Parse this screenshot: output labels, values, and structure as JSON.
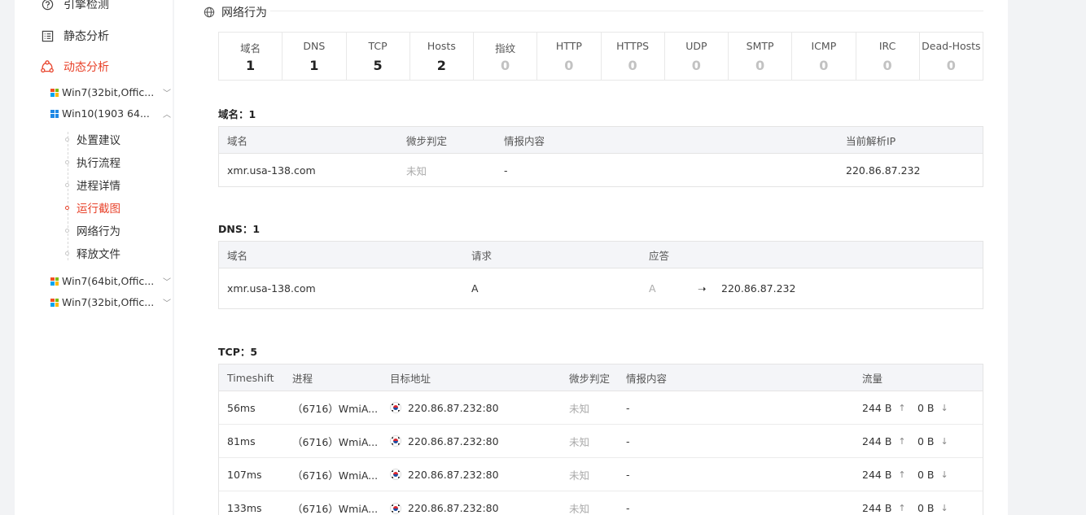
{
  "sidebar": {
    "nav": [
      {
        "label": "引擎检测",
        "icon": "question-circle-icon"
      },
      {
        "label": "静态分析",
        "icon": "list-icon"
      },
      {
        "label": "动态分析",
        "icon": "nodes-icon",
        "active": true
      }
    ],
    "envs": [
      {
        "label": "Win7(32bit,Offic...",
        "icon": "windows-xp-icon",
        "expanded": false
      },
      {
        "label": "Win10(1903 64...",
        "icon": "windows-10-icon",
        "expanded": true
      },
      {
        "label": "Win7(64bit,Offic...",
        "icon": "windows-xp-icon",
        "expanded": false
      },
      {
        "label": "Win7(32bit,Offic...",
        "icon": "windows-xp-icon",
        "expanded": false
      }
    ],
    "sub_items": [
      "处置建议",
      "执行流程",
      "进程详情",
      "运行截图",
      "网络行为",
      "释放文件"
    ],
    "active_sub": "运行截图"
  },
  "main": {
    "section_title": "网络行为",
    "stats": [
      {
        "label": "域名",
        "value": "1"
      },
      {
        "label": "DNS",
        "value": "1"
      },
      {
        "label": "TCP",
        "value": "5"
      },
      {
        "label": "Hosts",
        "value": "2"
      },
      {
        "label": "指纹",
        "value": "0"
      },
      {
        "label": "HTTP",
        "value": "0"
      },
      {
        "label": "HTTPS",
        "value": "0"
      },
      {
        "label": "UDP",
        "value": "0"
      },
      {
        "label": "SMTP",
        "value": "0"
      },
      {
        "label": "ICMP",
        "value": "0"
      },
      {
        "label": "IRC",
        "value": "0"
      },
      {
        "label": "Dead-Hosts",
        "value": "0"
      }
    ],
    "domain": {
      "title": "域名：1",
      "headers": [
        "域名",
        "微步判定",
        "情报内容",
        "当前解析IP"
      ],
      "rows": [
        [
          "xmr.usa-138.com",
          "未知",
          "-",
          "220.86.87.232"
        ]
      ]
    },
    "dns": {
      "title": "DNS：1",
      "headers": [
        "域名",
        "请求",
        "应答"
      ],
      "rows": [
        [
          "xmr.usa-138.com",
          "A",
          "A",
          "220.86.87.232"
        ]
      ]
    },
    "tcp": {
      "title": "TCP：5",
      "headers": [
        "Timeshift",
        "进程",
        "目标地址",
        "微步判定",
        "情报内容",
        "流量"
      ],
      "rows": [
        [
          "56ms",
          "（6716）WmiA...",
          "220.86.87.232:80",
          "未知",
          "-",
          "244 B",
          "0 B"
        ],
        [
          "81ms",
          "（6716）WmiA...",
          "220.86.87.232:80",
          "未知",
          "-",
          "244 B",
          "0 B"
        ],
        [
          "107ms",
          "（6716）WmiA...",
          "220.86.87.232:80",
          "未知",
          "-",
          "244 B",
          "0 B"
        ],
        [
          "133ms",
          "（6716）WmiA...",
          "220.86.87.232:80",
          "未知",
          "-",
          "244 B",
          "0 B"
        ]
      ]
    }
  },
  "colors": {
    "accent": "#e8432b",
    "muted": "#aaaaaa",
    "header_bg": "#f4f5f8"
  }
}
